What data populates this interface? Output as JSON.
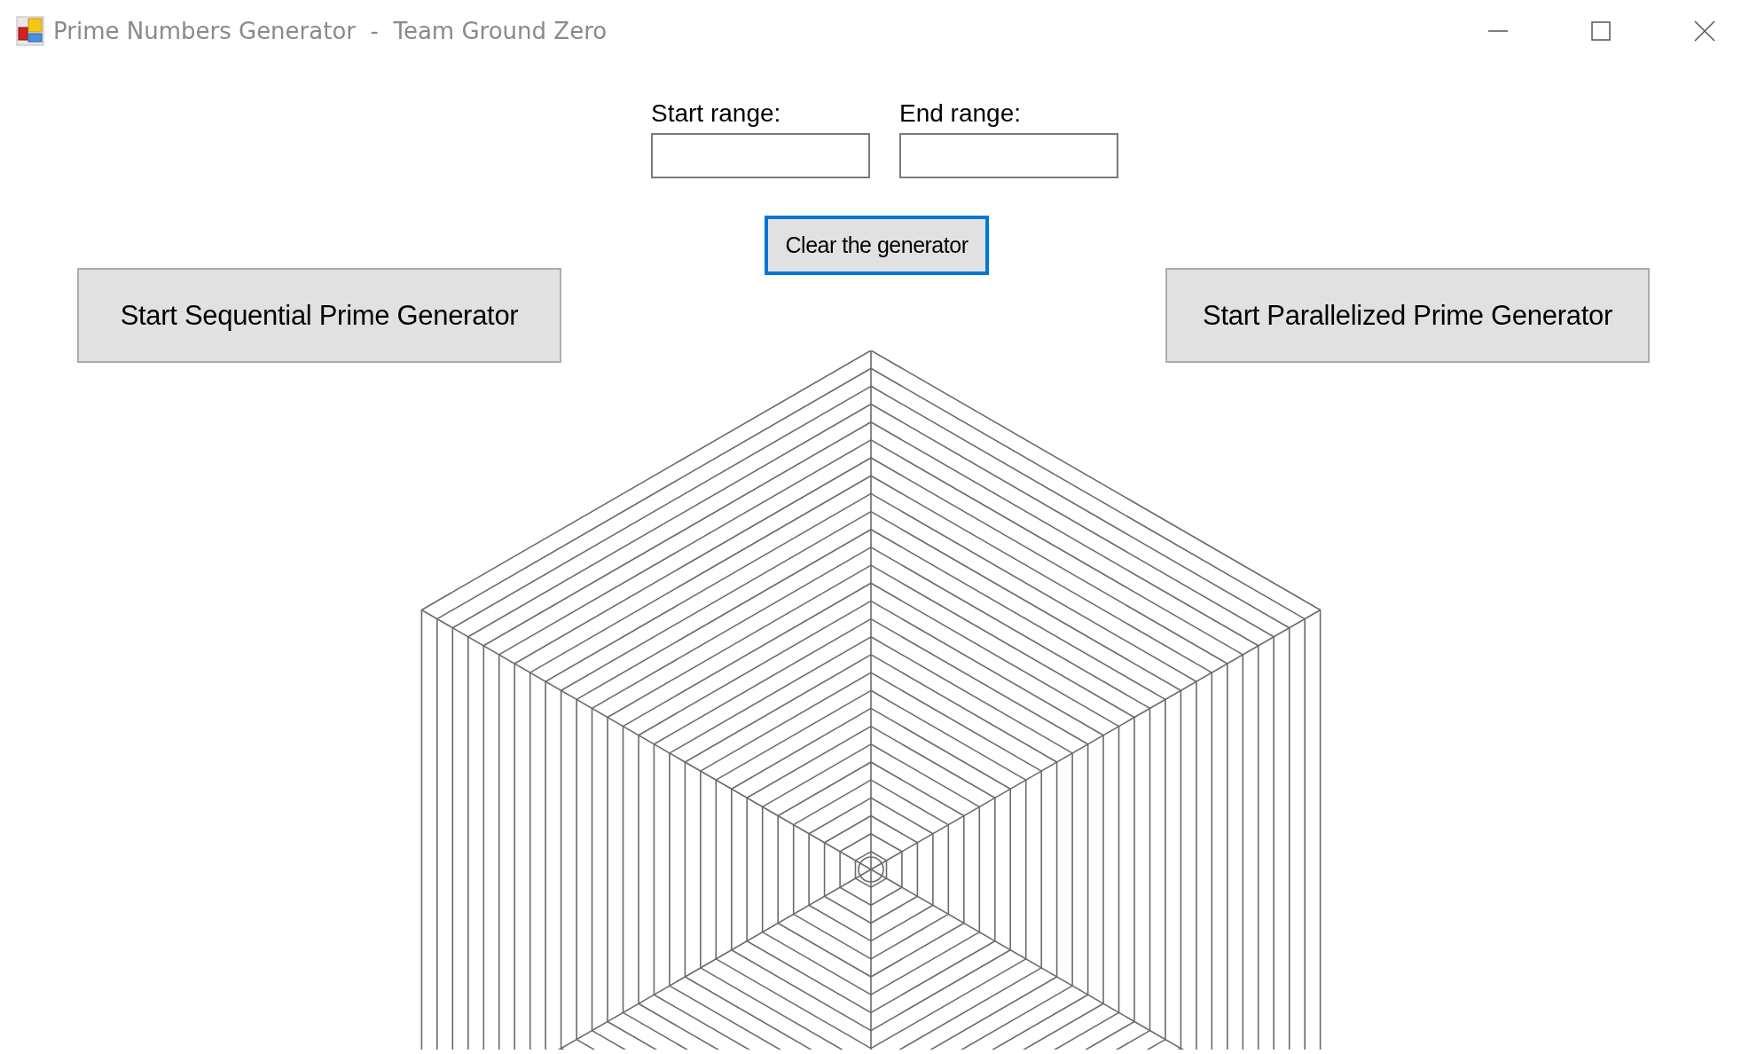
{
  "window": {
    "title": "Prime Numbers Generator  -  Team Ground Zero"
  },
  "fields": [
    {
      "label": "Start range:"
    },
    {
      "label": "End range:"
    }
  ],
  "clear_button": {
    "label": "Clear the generator",
    "focused": true
  },
  "buttons": [
    {
      "label": "Start Sequential Prime Generator"
    },
    {
      "label": "Start Parallelized Prime Generator"
    }
  ]
}
